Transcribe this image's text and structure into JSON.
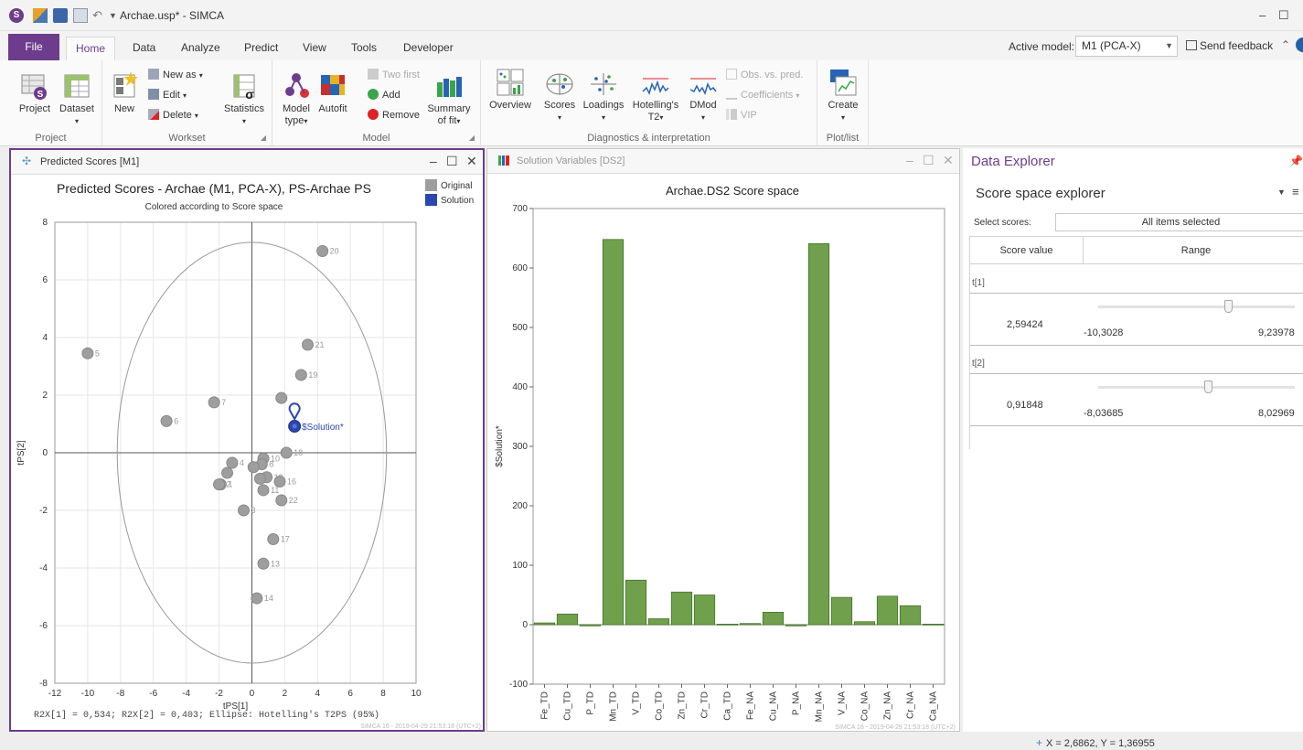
{
  "window": {
    "title": "Archae.usp* - SIMCA"
  },
  "ribbon_tabs": [
    "File",
    "Home",
    "Data",
    "Analyze",
    "Predict",
    "View",
    "Tools",
    "Developer"
  ],
  "active_model": {
    "label": "Active model:",
    "value": "M1 (PCA-X)"
  },
  "send_feedback": "Send feedback",
  "ribbon": {
    "project_group": {
      "label": "Project",
      "project": "Project",
      "dataset": "Dataset"
    },
    "workset_group": {
      "label": "Workset",
      "new": "New",
      "new_as": "New as",
      "edit": "Edit",
      "delete": "Delete",
      "statistics": "Statistics"
    },
    "model_group": {
      "label": "Model",
      "model_type_1": "Model",
      "model_type_2": "type",
      "autofit": "Autofit",
      "two_first": "Two first",
      "add": "Add",
      "remove": "Remove",
      "summary_1": "Summary",
      "summary_2": "of fit"
    },
    "diag_group": {
      "label": "Diagnostics & interpretation",
      "overview": "Overview",
      "scores": "Scores",
      "loadings": "Loadings",
      "hotellings_1": "Hotelling's",
      "hotellings_2": "T2",
      "dmod": "DMod",
      "obs_vs_pred": "Obs. vs. pred.",
      "coefficients": "Coefficients",
      "vip": "VIP"
    },
    "plot_group": {
      "label": "Plot/list",
      "create": "Create"
    }
  },
  "scores_panel": {
    "tab_title": "Predicted Scores [M1]",
    "plot_title": "Predicted Scores - Archae (M1, PCA-X), PS-Archae PS",
    "plot_subtitle": "Colored according to Score space",
    "legend": [
      {
        "label": "Original",
        "color": "#9e9e9e"
      },
      {
        "label": "Solution",
        "color": "#2a46b0"
      }
    ],
    "footer": "R2X[1] = 0,534; R2X[2] = 0,403; Ellipse: Hotelling's T2PS (95%)",
    "watermark": "SIMCA 16 - 2019-04-29 21:53:18 (UTC+2)",
    "chart_data": {
      "type": "scatter",
      "xlabel": "tPS[1]",
      "ylabel": "tPS[2]",
      "xlim": [
        -12,
        10
      ],
      "ylim": [
        -8,
        8
      ],
      "xticks": [
        -12,
        -10,
        -8,
        -6,
        -4,
        -2,
        0,
        2,
        4,
        6,
        8,
        10
      ],
      "yticks": [
        -8,
        -6,
        -4,
        -2,
        0,
        2,
        4,
        6,
        8
      ],
      "ellipse": {
        "rx": 8.2,
        "ry": 7.3
      },
      "points": [
        {
          "x": 4.3,
          "y": 7.0,
          "label": "20"
        },
        {
          "x": -10.0,
          "y": 3.45,
          "label": "5"
        },
        {
          "x": 3.4,
          "y": 3.75,
          "label": "21"
        },
        {
          "x": 3.0,
          "y": 2.7,
          "label": "19"
        },
        {
          "x": -2.3,
          "y": 1.75,
          "label": "7"
        },
        {
          "x": 1.8,
          "y": 1.9,
          "label": ""
        },
        {
          "x": -5.2,
          "y": 1.1,
          "label": "6"
        },
        {
          "x": 0.7,
          "y": -0.2,
          "label": "10"
        },
        {
          "x": 2.1,
          "y": 0.0,
          "label": "18"
        },
        {
          "x": 0.6,
          "y": -0.4,
          "label": "8"
        },
        {
          "x": -1.2,
          "y": -0.35,
          "label": "4"
        },
        {
          "x": 0.1,
          "y": -0.5,
          "label": "9"
        },
        {
          "x": -1.5,
          "y": -0.7,
          "label": ""
        },
        {
          "x": 0.9,
          "y": -0.85,
          "label": "12"
        },
        {
          "x": 0.5,
          "y": -0.9,
          "label": ""
        },
        {
          "x": 1.7,
          "y": -1.0,
          "label": "16"
        },
        {
          "x": -1.9,
          "y": -1.1,
          "label": "1"
        },
        {
          "x": -2.0,
          "y": -1.1,
          "label": "2"
        },
        {
          "x": 0.7,
          "y": -1.3,
          "label": "11"
        },
        {
          "x": 1.8,
          "y": -1.65,
          "label": "22"
        },
        {
          "x": -0.5,
          "y": -2.0,
          "label": "3"
        },
        {
          "x": 1.3,
          "y": -3.0,
          "label": "17"
        },
        {
          "x": 0.7,
          "y": -3.85,
          "label": "13"
        },
        {
          "x": 0.3,
          "y": -5.05,
          "label": "14"
        }
      ],
      "solution_point": {
        "x": 2.6,
        "y": 0.92,
        "label": "$Solution*"
      }
    }
  },
  "bar_panel": {
    "tab_title": "Solution Variables [DS2]",
    "watermark": "SIMCA 16 - 2019-04-29 21:53:18 (UTC+2)",
    "chart_data": {
      "type": "bar",
      "title": "Archae.DS2 Score space",
      "ylabel": "$Solution*",
      "ylim": [
        -100,
        700
      ],
      "yticks": [
        -100,
        0,
        100,
        200,
        300,
        400,
        500,
        600,
        700
      ],
      "color": "#70a04b",
      "categories": [
        "Fe_TD",
        "Cu_TD",
        "P_TD",
        "Mn_TD",
        "V_TD",
        "Co_TD",
        "Zn_TD",
        "Cr_TD",
        "Ca_TD",
        "Fe_NA",
        "Cu_NA",
        "P_NA",
        "Mn_NA",
        "V_NA",
        "Co_NA",
        "Zn_NA",
        "Cr_NA",
        "Ca_NA"
      ],
      "values": [
        3,
        18,
        -2,
        648,
        75,
        10,
        55,
        50,
        1,
        2,
        21,
        -2,
        641,
        46,
        5,
        48,
        32,
        1
      ]
    }
  },
  "explorer": {
    "title": "Data Explorer",
    "subtitle": "Score space explorer",
    "select_label": "Select scores:",
    "select_value": "All items selected",
    "col_score": "Score value",
    "col_range": "Range",
    "rows": [
      {
        "name": "t[1]",
        "value": "2,59424",
        "min": "-10,3028",
        "max": "9,23978",
        "fraction": 0.661
      },
      {
        "name": "t[2]",
        "value": "0,91848",
        "min": "-8,03685",
        "max": "8,02969",
        "fraction": 0.557
      }
    ]
  },
  "status": {
    "cursor": "X = 2,6862, Y = 1,36955"
  }
}
